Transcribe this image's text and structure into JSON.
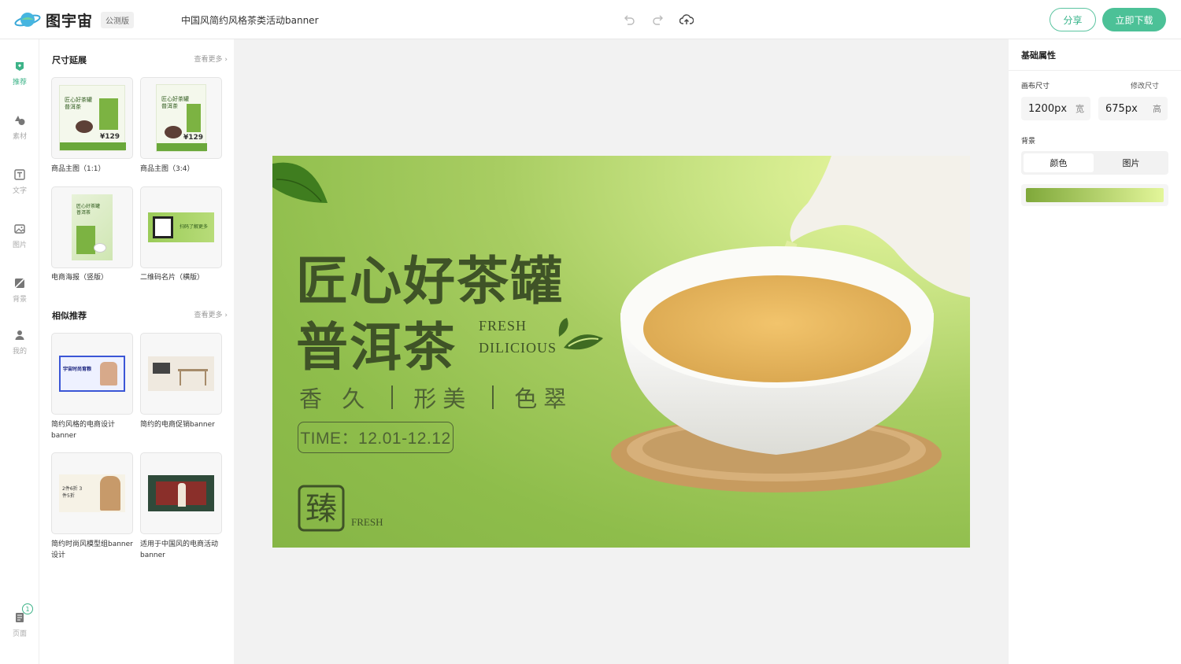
{
  "header": {
    "app_name": "图宇宙",
    "beta_badge": "公测版",
    "doc_title": "中国风简约风格茶类活动banner",
    "share_label": "分享",
    "download_label": "立即下载"
  },
  "rail": {
    "items": [
      {
        "label": "推荐",
        "icon": "recommend-icon"
      },
      {
        "label": "素材",
        "icon": "shapes-icon"
      },
      {
        "label": "文字",
        "icon": "text-icon"
      },
      {
        "label": "图片",
        "icon": "image-icon"
      },
      {
        "label": "背景",
        "icon": "background-icon"
      },
      {
        "label": "我的",
        "icon": "user-icon"
      }
    ],
    "pages_label": "页面",
    "pages_count": "1"
  },
  "panel": {
    "size_ext": {
      "title": "尺寸延展",
      "more": "查看更多",
      "cards": [
        {
          "label": "商品主图（1:1）"
        },
        {
          "label": "商品主图（3:4）"
        },
        {
          "label": "电商海报（竖版）"
        },
        {
          "label": "二维码名片（横版）"
        }
      ]
    },
    "similar": {
      "title": "相似推荐",
      "more": "查看更多",
      "cards": [
        {
          "label": "简约风格的电商设计banner"
        },
        {
          "label": "简约的电商促销banner"
        },
        {
          "label": "简约时尚风模型组banner设计"
        },
        {
          "label": "适用于中国风的电商活动banner"
        }
      ]
    },
    "thumb_texts": {
      "tea_title_a": "匠心好茶罐",
      "tea_title_b": "普洱茶",
      "price": "¥129",
      "qr_text": "扫码了解更多",
      "sim1_text": "宇宙时尚育粮",
      "sim3_text": "2件6折 3件5折"
    }
  },
  "banner": {
    "title_line1": "匠心好茶罐",
    "title_line2": "普洱茶",
    "fresh": "FRESH",
    "delicious": "DILICIOUS",
    "features": [
      "香 久",
      "形美",
      "色翠"
    ],
    "time_text": "TIME：12.01-12.12",
    "fresh_bottom": "FRESH",
    "seal_char": "臻"
  },
  "props": {
    "title": "基础属性",
    "canvas_size_label": "画布尺寸",
    "resize_label": "修改尺寸",
    "width_value": "1200px",
    "width_unit": "宽",
    "height_value": "675px",
    "height_unit": "高",
    "bg_label": "背景",
    "bg_options": [
      "颜色",
      "图片"
    ],
    "bg_selected": "颜色",
    "gradient": {
      "from": "#7fa83a",
      "to": "#e3f69a"
    }
  },
  "colors": {
    "accent": "#4cc197",
    "banner_text": "#3f5327"
  }
}
